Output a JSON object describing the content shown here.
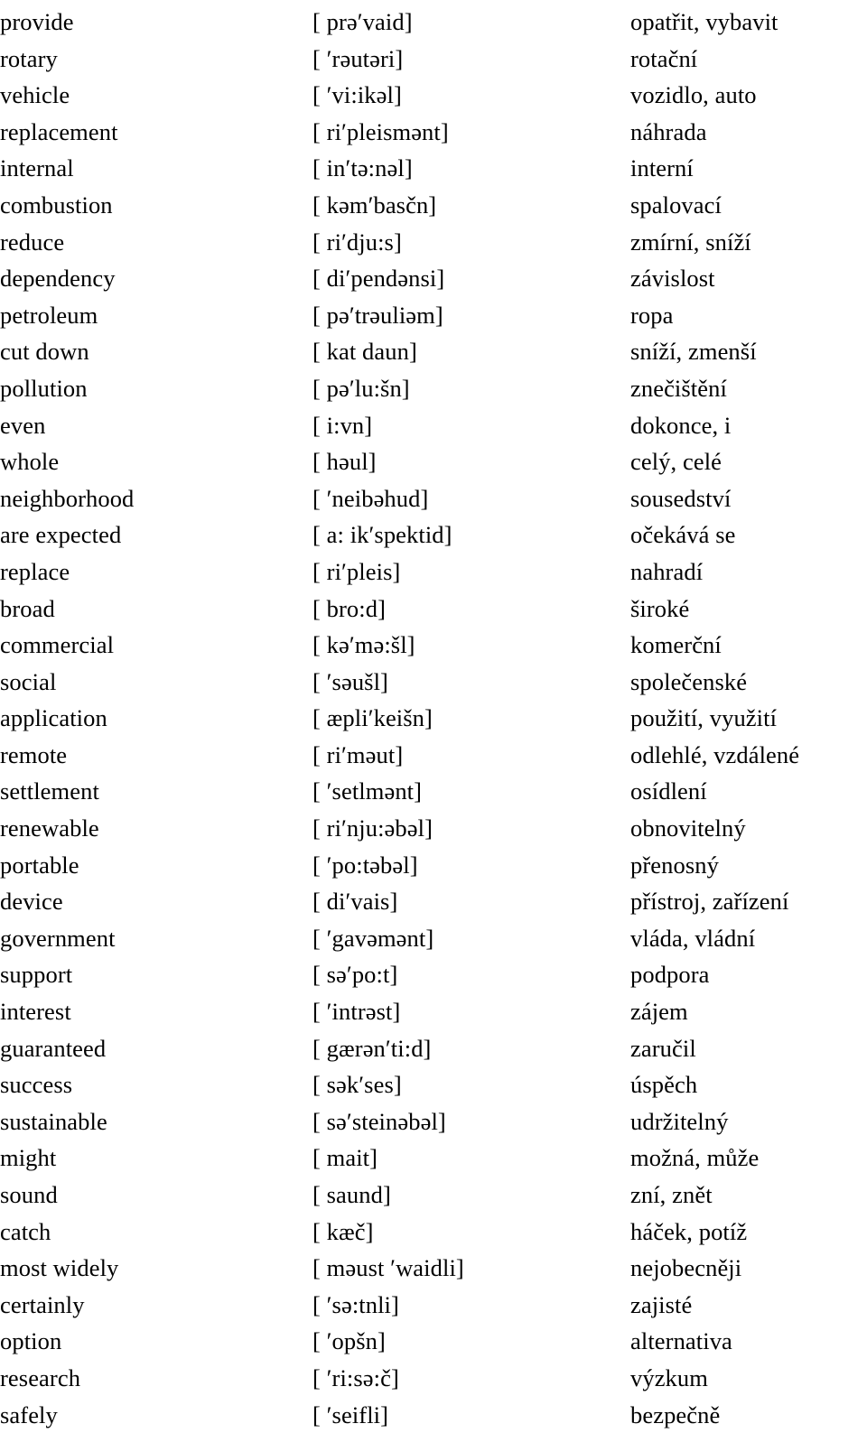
{
  "document": {
    "type": "vocabulary-list",
    "columns": [
      "word",
      "phonetic",
      "translation"
    ],
    "language_pair": "English – Czech",
    "row_count": 38
  },
  "rows": [
    {
      "word": "provide",
      "phonetic": "[ prə′vaid]",
      "translation": "opatřit, vybavit"
    },
    {
      "word": "rotary",
      "phonetic": "[ ′rəutəri]",
      "translation": "rotační"
    },
    {
      "word": "vehicle",
      "phonetic": "[ ′vi:ikəl]",
      "translation": "vozidlo, auto"
    },
    {
      "word": "replacement",
      "phonetic": "[ ri′pleismənt]",
      "translation": "náhrada"
    },
    {
      "word": "internal",
      "phonetic": "[ in′tə:nəl]",
      "translation": "interní"
    },
    {
      "word": "combustion",
      "phonetic": "[ kəm′basčn]",
      "translation": "spalovací"
    },
    {
      "word": "reduce",
      "phonetic": "[ ri′dju:s]",
      "translation": "zmírní, sníží"
    },
    {
      "word": "dependency",
      "phonetic": "[ di′pendənsi]",
      "translation": "závislost"
    },
    {
      "word": "petroleum",
      "phonetic": "[ pə′trəuliəm]",
      "translation": "ropa"
    },
    {
      "word": "cut down",
      "phonetic": "[ kat daun]",
      "translation": "sníží, zmenší"
    },
    {
      "word": "pollution",
      "phonetic": "[ pə′lu:šn]",
      "translation": "znečištění"
    },
    {
      "word": "even",
      "phonetic": "[ i:vn]",
      "translation": "dokonce, i"
    },
    {
      "word": "whole",
      "phonetic": "[ həul]",
      "translation": "celý, celé"
    },
    {
      "word": "neighborhood",
      "phonetic": "[ ′neibəhud]",
      "translation": "sousedství"
    },
    {
      "word": "are expected",
      "phonetic": "[ a: ik′spektid]",
      "translation": "očekává se"
    },
    {
      "word": "replace",
      "phonetic": "[ ri′pleis]",
      "translation": "nahradí"
    },
    {
      "word": "broad",
      "phonetic": "[ bro:d]",
      "translation": "široké"
    },
    {
      "word": "commercial",
      "phonetic": "[ kə′mə:šl]",
      "translation": "komerční"
    },
    {
      "word": "social",
      "phonetic": "[ ′səušl]",
      "translation": "společenské"
    },
    {
      "word": "application",
      "phonetic": "[ æpli′keišn]",
      "translation": "použití, využití"
    },
    {
      "word": "remote",
      "phonetic": "[ ri′məut]",
      "translation": "odlehlé, vzdálené"
    },
    {
      "word": "settlement",
      "phonetic": "[ ′setlmənt]",
      "translation": "osídlení"
    },
    {
      "word": "renewable",
      "phonetic": "[ ri′nju:əbəl]",
      "translation": "obnovitelný"
    },
    {
      "word": "portable",
      "phonetic": "[ ′po:təbəl]",
      "translation": "přenosný"
    },
    {
      "word": "device",
      "phonetic": "[ di′vais]",
      "translation": "přístroj, zařízení"
    },
    {
      "word": "government",
      "phonetic": "[ ′gavəmənt]",
      "translation": "vláda, vládní"
    },
    {
      "word": "support",
      "phonetic": "[ sə′po:t]",
      "translation": "podpora"
    },
    {
      "word": "interest",
      "phonetic": "[ ′intrəst]",
      "translation": "zájem"
    },
    {
      "word": "guaranteed",
      "phonetic": "[ gærən′ti:d]",
      "translation": "zaručil"
    },
    {
      "word": "success",
      "phonetic": "[ sək′ses]",
      "translation": "úspěch"
    },
    {
      "word": "sustainable",
      "phonetic": "[ sə′steinəbəl]",
      "translation": "udržitelný"
    },
    {
      "word": "might",
      "phonetic": "[ mait]",
      "translation": "možná, může"
    },
    {
      "word": "sound",
      "phonetic": "[ saund]",
      "translation": "zní, znět"
    },
    {
      "word": "catch",
      "phonetic": "[ kæč]",
      "translation": "háček, potíž"
    },
    {
      "word": "most widely",
      "phonetic": "[ məust ′waidli]",
      "translation": "nejobecněji"
    },
    {
      "word": "certainly",
      "phonetic": "[ ′sə:tnli]",
      "translation": "zajisté"
    },
    {
      "word": "option",
      "phonetic": "[ ′opšn]",
      "translation": "alternativa"
    },
    {
      "word": "research",
      "phonetic": "[ ′ri:sə:č]",
      "translation": "výzkum"
    },
    {
      "word": "safely",
      "phonetic": "[ ′seifli]",
      "translation": "bezpečně"
    }
  ]
}
